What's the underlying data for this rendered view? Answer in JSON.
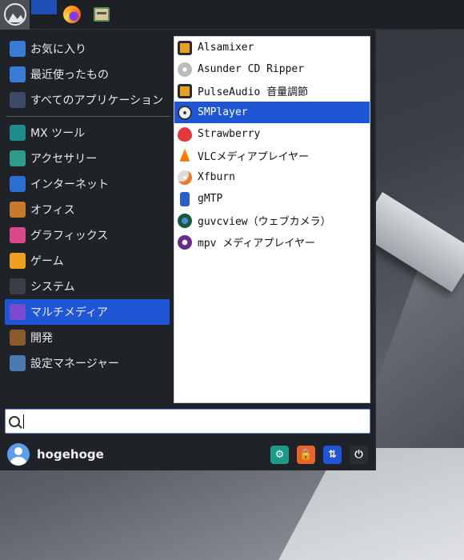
{
  "categories": [
    {
      "label": "お気に入り",
      "icon": "favorites-folder-icon",
      "color": "#3a7ad8"
    },
    {
      "label": "最近使ったもの",
      "icon": "recent-folder-icon",
      "color": "#3a7ad8"
    },
    {
      "label": "すべてのアプリケーション",
      "icon": "all-apps-icon",
      "color": "#3b4a66"
    },
    {
      "label": "MX ツール",
      "icon": "mx-tools-icon",
      "color": "#1f8a8a"
    },
    {
      "label": "アクセサリー",
      "icon": "accessories-icon",
      "color": "#2e9a8a"
    },
    {
      "label": "インターネット",
      "icon": "internet-icon",
      "color": "#2a6fd0"
    },
    {
      "label": "オフィス",
      "icon": "office-briefcase-icon",
      "color": "#c77a2a"
    },
    {
      "label": "グラフィックス",
      "icon": "graphics-icon",
      "color": "#d84a8a"
    },
    {
      "label": "ゲーム",
      "icon": "games-gamepad-icon",
      "color": "#f0a020"
    },
    {
      "label": "システム",
      "icon": "system-gear-icon",
      "color": "#3a3f46"
    },
    {
      "label": "マルチメディア",
      "icon": "multimedia-icon",
      "color": "#7a4ad0"
    },
    {
      "label": "開発",
      "icon": "development-hammer-icon",
      "color": "#8a5a2a"
    },
    {
      "label": "設定マネージャー",
      "icon": "settings-manager-icon",
      "color": "#4a7ab0"
    }
  ],
  "active_category": "マルチメディア",
  "apps": [
    {
      "label": "Alsamixer",
      "icon": "speaker-icon"
    },
    {
      "label": "Asunder CD Ripper",
      "icon": "cd-icon"
    },
    {
      "label": "PulseAudio 音量調節",
      "icon": "speaker-icon"
    },
    {
      "label": "SMPlayer",
      "icon": "smplayer-film-reel-icon"
    },
    {
      "label": "Strawberry",
      "icon": "strawberry-icon"
    },
    {
      "label": "VLCメディアプレイヤー",
      "icon": "vlc-cone-icon"
    },
    {
      "label": "Xfburn",
      "icon": "xfburn-disc-icon"
    },
    {
      "label": "gMTP",
      "icon": "media-player-device-icon"
    },
    {
      "label": "guvcview（ウェブカメラ）",
      "icon": "webcam-icon"
    },
    {
      "label": "mpv メディアプレイヤー",
      "icon": "mpv-play-icon"
    }
  ],
  "selected_app": "SMPlayer",
  "search": {
    "value": "",
    "placeholder": ""
  },
  "user": {
    "name": "hogehoge"
  },
  "actions": [
    {
      "icon": "settings-wrench-icon",
      "color": "#1e9a8a"
    },
    {
      "icon": "lock-icon",
      "color": "#e8642a"
    },
    {
      "icon": "switch-user-arrows-icon",
      "color": "#1f56d6"
    },
    {
      "icon": "logout-icon",
      "color": "#2a2d31"
    }
  ],
  "colors": {
    "accent": "#1f56d6",
    "menu_bg": "#1f2226",
    "panel_bg": "#1d2024"
  }
}
